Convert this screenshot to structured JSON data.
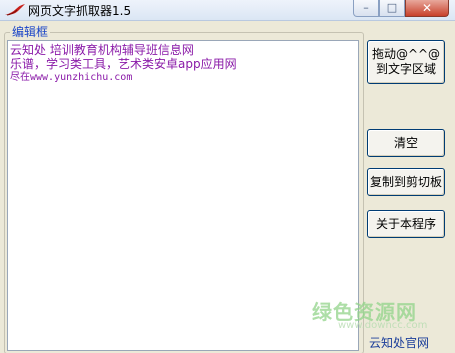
{
  "window": {
    "title": "网页文字抓取器1.5",
    "caption_buttons": {
      "minimize": "minimize-icon",
      "maximize": "maximize-icon",
      "close": "close-icon"
    }
  },
  "group": {
    "label": "编辑框"
  },
  "editor": {
    "lines": [
      "云知处 培训教育机构辅导班信息网",
      "乐谱，学习类工具，艺术类安卓app应用网",
      "尽在www.yunzhichu.com"
    ],
    "text_color": "#8a1aa8"
  },
  "buttons": {
    "drag": "拖动@^^@到文字区域",
    "clear": "清空",
    "copy": "复制到剪切板",
    "about": "关于本程序"
  },
  "watermark": {
    "text": "绿色资源网",
    "sub": "www.downcc.com"
  },
  "footer": {
    "link": "云知处官网"
  }
}
